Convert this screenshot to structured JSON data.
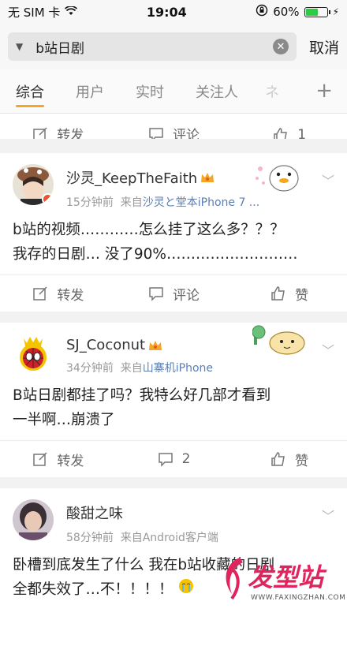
{
  "status_bar": {
    "carrier": "无 SIM 卡",
    "time": "19:04",
    "battery": "60%",
    "battery_level": 0.6
  },
  "search": {
    "value": "b站日剧",
    "cancel": "取消"
  },
  "tabs": [
    {
      "label": "综合"
    },
    {
      "label": "用户"
    },
    {
      "label": "实时"
    },
    {
      "label": "关注人"
    },
    {
      "label": "ネ"
    }
  ],
  "prev_actions": {
    "repost": "转发",
    "comment": "评论",
    "like": "1"
  },
  "posts": [
    {
      "name": "沙灵_KeepTheFaith",
      "time": "15分钟前",
      "from": "来自",
      "source": "沙灵と堂本iPhone 7 ...",
      "lines": [
        "b站的视频…………怎么挂了这么多？？？",
        "我存的日剧… 没了90%………………………"
      ],
      "repost": "转发",
      "comment": "评论",
      "like": "赞"
    },
    {
      "name": "SJ_Coconut",
      "time": "34分钟前",
      "from": "来自",
      "source": "山寨机iPhone",
      "lines": [
        "B站日剧都挂了吗？我特么好几部才看到",
        "一半啊…崩溃了"
      ],
      "repost": "转发",
      "comment": "2",
      "like": "赞"
    },
    {
      "name": "酸甜之味",
      "time": "58分钟前",
      "from": "来自Android客户端",
      "source": "",
      "lines": [
        "卧槽到底发生了什么 我在b站收藏的日剧",
        "全都失效了…不！！！！"
      ],
      "repost": "",
      "comment": "",
      "like": ""
    }
  ],
  "watermark": {
    "main": "发型站",
    "url": "WWW.FAXINGZHAN.COM"
  },
  "colors": {
    "accent": "#f5a623",
    "link": "#5b7fb1",
    "watermark": "#e0245e"
  }
}
